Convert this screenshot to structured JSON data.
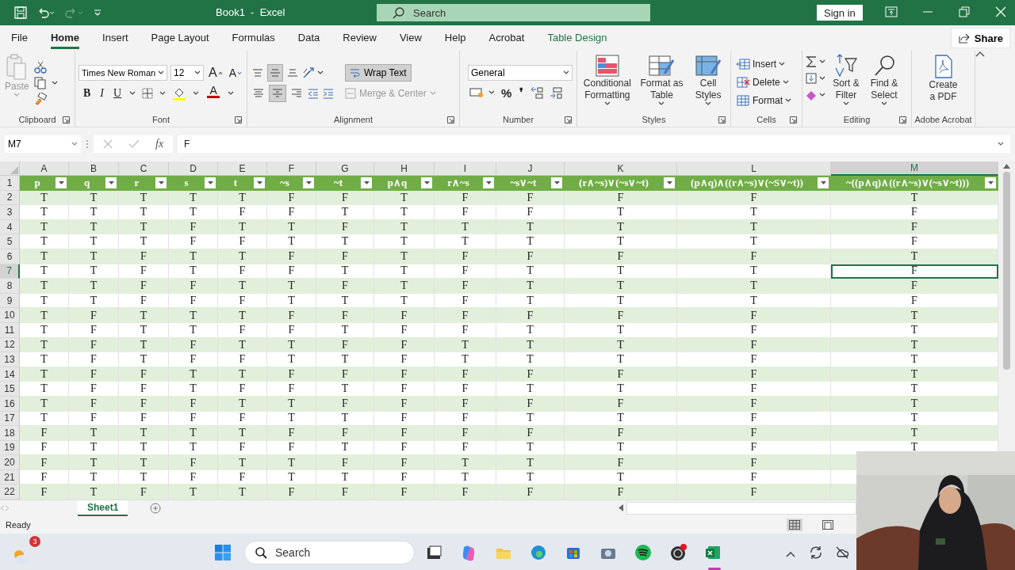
{
  "title_bar": {
    "title": "Book1  -  Excel",
    "search_placeholder": "Search",
    "sign_in": "Sign in"
  },
  "menu_tabs": [
    {
      "label": "File",
      "selected": false,
      "contextual": false
    },
    {
      "label": "Home",
      "selected": true,
      "contextual": false
    },
    {
      "label": "Insert",
      "selected": false,
      "contextual": false
    },
    {
      "label": "Page Layout",
      "selected": false,
      "contextual": false
    },
    {
      "label": "Formulas",
      "selected": false,
      "contextual": false
    },
    {
      "label": "Data",
      "selected": false,
      "contextual": false
    },
    {
      "label": "Review",
      "selected": false,
      "contextual": false
    },
    {
      "label": "View",
      "selected": false,
      "contextual": false
    },
    {
      "label": "Help",
      "selected": false,
      "contextual": false
    },
    {
      "label": "Acrobat",
      "selected": false,
      "contextual": false
    },
    {
      "label": "Table Design",
      "selected": false,
      "contextual": true
    }
  ],
  "share": "Share",
  "ribbon": {
    "clipboard": {
      "label": "Clipboard",
      "paste": "Paste",
      "paste_disabled": true
    },
    "font": {
      "label": "Font",
      "name": "Times New Roman",
      "size": "12",
      "grow": "A",
      "shrink": "A",
      "styles": [
        "B",
        "I",
        "U"
      ],
      "color_letter": "A"
    },
    "alignment": {
      "label": "Alignment",
      "vertical": [
        {
          "selected": false
        },
        {
          "selected": true
        },
        {
          "selected": false
        }
      ],
      "horizontal": [
        {
          "selected": false
        },
        {
          "selected": true
        },
        {
          "selected": false
        }
      ],
      "wrap_text": {
        "label": "Wrap Text",
        "on": true
      },
      "merge": {
        "label": "Merge & Center",
        "disabled": true
      }
    },
    "number": {
      "label": "Number",
      "format": "General",
      "symbols": [
        "%",
        "❜"
      ]
    },
    "styles": {
      "label": "Styles",
      "items": [
        "Conditional Formatting",
        "Format as Table",
        "Cell Styles"
      ]
    },
    "cells": {
      "label": "Cells",
      "items": [
        "Insert",
        "Delete",
        "Format"
      ]
    },
    "editing": {
      "label": "Editing",
      "items": [
        "Sort & Filter",
        "Find & Select"
      ]
    },
    "acrobat": {
      "label": "Adobe Acrobat",
      "item": "Create a PDF"
    }
  },
  "formula_bar": {
    "name_box": "M7",
    "function_label": "fx",
    "value": "F"
  },
  "sheet": {
    "columns": [
      {
        "letter": "A",
        "selected": false
      },
      {
        "letter": "B",
        "selected": false
      },
      {
        "letter": "C",
        "selected": false
      },
      {
        "letter": "D",
        "selected": false
      },
      {
        "letter": "E",
        "selected": false
      },
      {
        "letter": "F",
        "selected": false
      },
      {
        "letter": "G",
        "selected": false
      },
      {
        "letter": "H",
        "selected": false
      },
      {
        "letter": "I",
        "selected": false
      },
      {
        "letter": "J",
        "selected": false
      },
      {
        "letter": "K",
        "selected": false
      },
      {
        "letter": "L",
        "selected": false
      },
      {
        "letter": "M",
        "selected": true
      }
    ],
    "header_row_number": "1",
    "header": [
      "p",
      "q",
      "r",
      "s",
      "t",
      "~s",
      "~t",
      "p∧q",
      "r∧~s",
      "~s∨~t",
      "(r∧~s)∨(~s∨~t)",
      "(p∧q)∧((r∧~s)∨(~S∨~t))",
      "~((p∧q)∧((r∧~s)∨(~s∨~t)))"
    ],
    "rows": [
      {
        "number": "2",
        "selected": false,
        "cells": [
          "T",
          "T",
          "T",
          "T",
          "T",
          "F",
          "F",
          "T",
          "F",
          "F",
          "F",
          "F",
          "T"
        ]
      },
      {
        "number": "3",
        "selected": false,
        "cells": [
          "T",
          "T",
          "T",
          "T",
          "F",
          "F",
          "T",
          "T",
          "F",
          "F",
          "T",
          "T",
          "F"
        ]
      },
      {
        "number": "4",
        "selected": false,
        "cells": [
          "T",
          "T",
          "T",
          "F",
          "T",
          "T",
          "F",
          "T",
          "T",
          "T",
          "T",
          "T",
          "F"
        ]
      },
      {
        "number": "5",
        "selected": false,
        "cells": [
          "T",
          "T",
          "T",
          "F",
          "F",
          "T",
          "T",
          "T",
          "T",
          "T",
          "T",
          "T",
          "F"
        ]
      },
      {
        "number": "6",
        "selected": false,
        "cells": [
          "T",
          "T",
          "F",
          "T",
          "T",
          "F",
          "F",
          "T",
          "F",
          "F",
          "F",
          "F",
          "T"
        ]
      },
      {
        "number": "7",
        "selected": true,
        "cells": [
          "T",
          "T",
          "F",
          "T",
          "F",
          "F",
          "T",
          "T",
          "F",
          "T",
          "T",
          "T",
          "F"
        ]
      },
      {
        "number": "8",
        "selected": false,
        "cells": [
          "T",
          "T",
          "F",
          "F",
          "T",
          "T",
          "F",
          "T",
          "F",
          "T",
          "T",
          "T",
          "F"
        ]
      },
      {
        "number": "9",
        "selected": false,
        "cells": [
          "T",
          "T",
          "F",
          "F",
          "F",
          "T",
          "T",
          "T",
          "F",
          "T",
          "T",
          "T",
          "F"
        ]
      },
      {
        "number": "10",
        "selected": false,
        "cells": [
          "T",
          "F",
          "T",
          "T",
          "T",
          "F",
          "F",
          "F",
          "F",
          "F",
          "F",
          "F",
          "T"
        ]
      },
      {
        "number": "11",
        "selected": false,
        "cells": [
          "T",
          "F",
          "T",
          "T",
          "F",
          "F",
          "T",
          "F",
          "F",
          "T",
          "T",
          "F",
          "T"
        ]
      },
      {
        "number": "12",
        "selected": false,
        "cells": [
          "T",
          "F",
          "T",
          "F",
          "T",
          "T",
          "F",
          "F",
          "T",
          "T",
          "T",
          "F",
          "T"
        ]
      },
      {
        "number": "13",
        "selected": false,
        "cells": [
          "T",
          "F",
          "T",
          "F",
          "F",
          "T",
          "T",
          "F",
          "T",
          "T",
          "T",
          "F",
          "T"
        ]
      },
      {
        "number": "14",
        "selected": false,
        "cells": [
          "T",
          "F",
          "F",
          "T",
          "T",
          "F",
          "F",
          "F",
          "F",
          "F",
          "F",
          "F",
          "T"
        ]
      },
      {
        "number": "15",
        "selected": false,
        "cells": [
          "T",
          "F",
          "F",
          "T",
          "F",
          "F",
          "T",
          "F",
          "F",
          "T",
          "T",
          "F",
          "T"
        ]
      },
      {
        "number": "16",
        "selected": false,
        "cells": [
          "T",
          "F",
          "F",
          "F",
          "T",
          "T",
          "F",
          "F",
          "F",
          "F",
          "F",
          "F",
          "T"
        ]
      },
      {
        "number": "17",
        "selected": false,
        "cells": [
          "T",
          "F",
          "F",
          "F",
          "F",
          "T",
          "T",
          "F",
          "F",
          "T",
          "T",
          "F",
          "T"
        ]
      },
      {
        "number": "18",
        "selected": false,
        "cells": [
          "F",
          "T",
          "T",
          "T",
          "T",
          "F",
          "F",
          "F",
          "F",
          "F",
          "F",
          "F",
          "T"
        ]
      },
      {
        "number": "19",
        "selected": false,
        "cells": [
          "F",
          "T",
          "T",
          "T",
          "F",
          "F",
          "T",
          "F",
          "F",
          "T",
          "T",
          "F",
          "T"
        ]
      },
      {
        "number": "20",
        "selected": false,
        "cells": [
          "F",
          "T",
          "T",
          "F",
          "T",
          "T",
          "F",
          "F",
          "T",
          "T",
          "F",
          "F"
        ]
      },
      {
        "number": "21",
        "selected": false,
        "cells": [
          "F",
          "T",
          "T",
          "F",
          "F",
          "T",
          "T",
          "F",
          "T",
          "T",
          "T",
          "F"
        ]
      },
      {
        "number": "22",
        "selected": false,
        "cells": [
          "F",
          "T",
          "F",
          "T",
          "T",
          "F",
          "F",
          "F",
          "F",
          "F",
          "F",
          "F"
        ]
      }
    ]
  },
  "sheet_tabs": [
    {
      "label": "Sheet1",
      "selected": true
    }
  ],
  "status_bar": {
    "text": "Ready"
  },
  "taskbar": {
    "weather_badge": "3",
    "search_placeholder": "Search"
  }
}
